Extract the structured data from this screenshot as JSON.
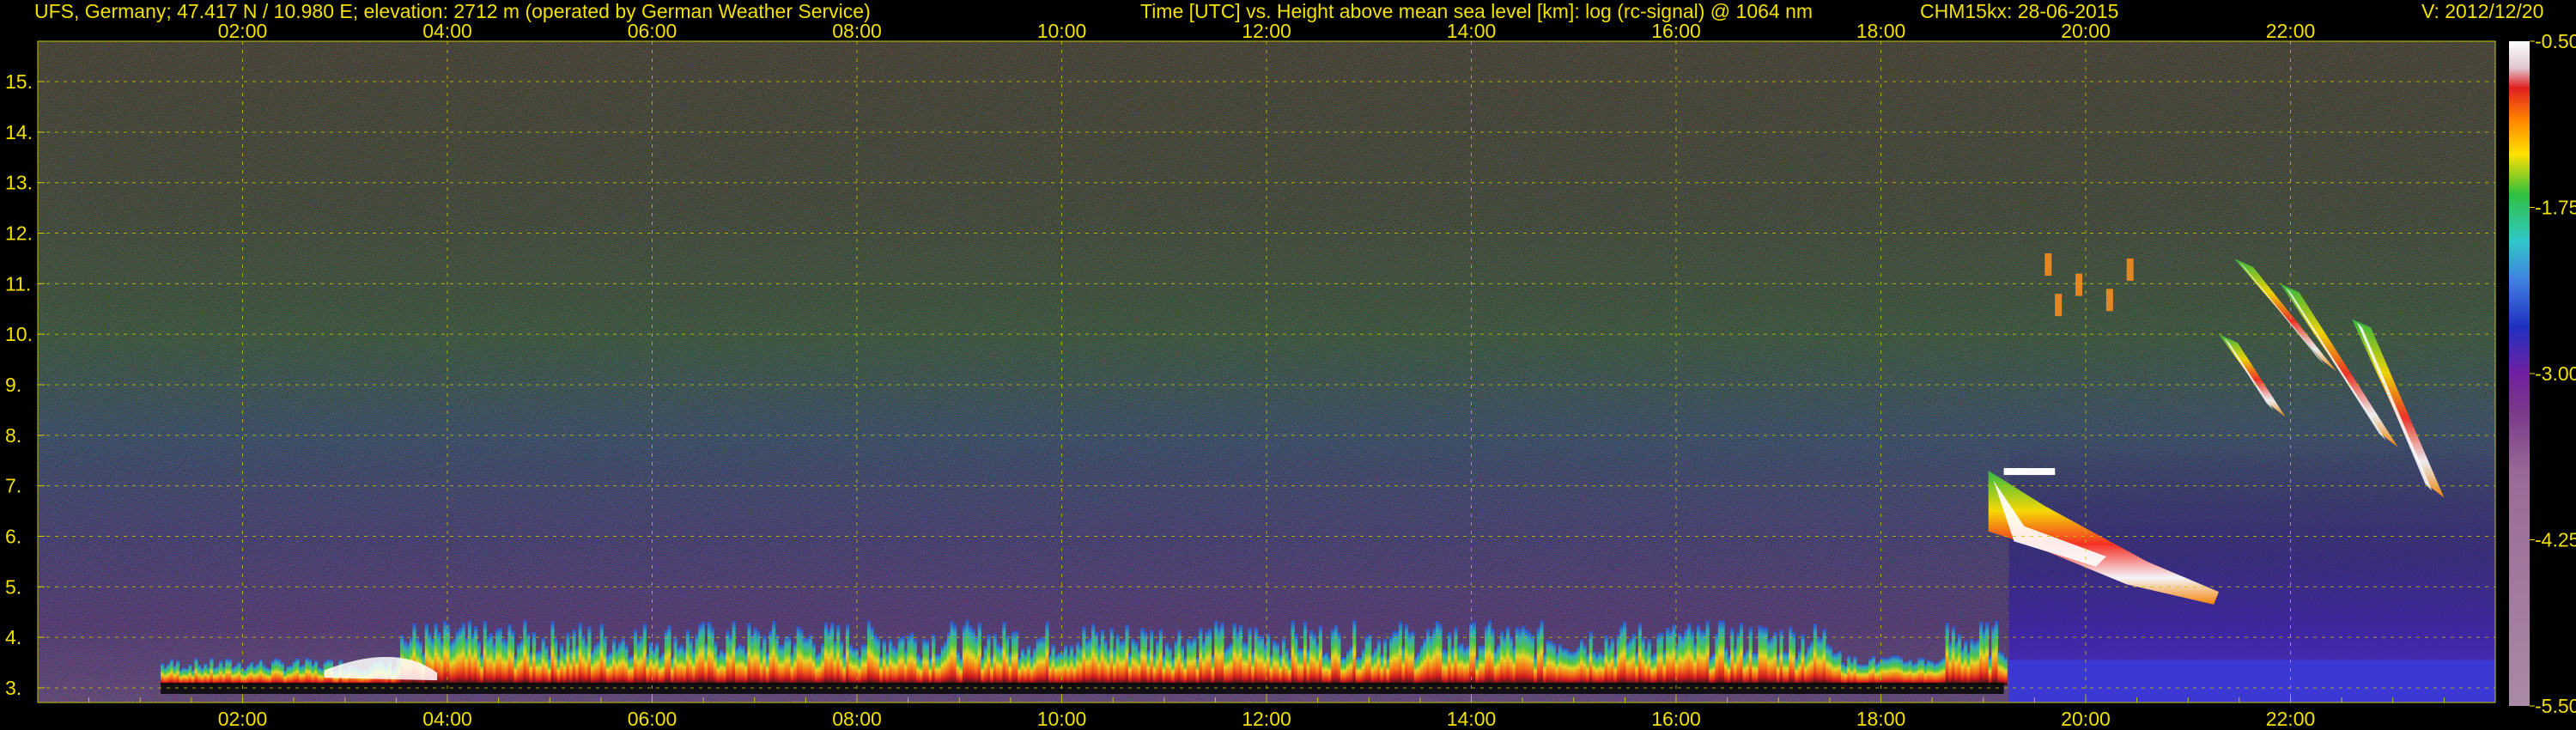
{
  "header": {
    "site": "UFS, Germany; 47.417 N / 10.980 E; elevation: 2712 m  (operated by German Weather Service)",
    "description": "Time [UTC] vs. Height above mean sea level [km]: log (rc-signal) @ 1064 nm",
    "instrument": "CHM15kx: 28-06-2015",
    "version": "V: 2012/12/20"
  },
  "colors": {
    "text": "#f0e000",
    "grid": "#c8c800",
    "background": "#000000"
  },
  "chart_data": {
    "type": "heatmap",
    "title": "Time [UTC] vs. Height above mean sea level [km]: log (rc-signal) @ 1064 nm",
    "x_tick_labels": [
      "02:00",
      "04:00",
      "06:00",
      "08:00",
      "10:00",
      "12:00",
      "14:00",
      "16:00",
      "18:00",
      "20:00",
      "22:00"
    ],
    "x_ticks_hours": [
      2,
      4,
      6,
      8,
      10,
      12,
      14,
      16,
      18,
      20,
      22
    ],
    "xlim_hours": [
      0,
      24
    ],
    "y_tick_labels": [
      "3.",
      "4.",
      "5.",
      "6.",
      "7.",
      "8.",
      "9.",
      "10.",
      "11.",
      "12.",
      "13.",
      "14.",
      "15."
    ],
    "y_ticks_km": [
      3,
      4,
      5,
      6,
      7,
      8,
      9,
      10,
      11,
      12,
      13,
      14,
      15
    ],
    "ylim_km": [
      2.71,
      15.8
    ],
    "grid": true,
    "colorbar": {
      "tick_labels": [
        "-0.50",
        "-1.75",
        "-3.00",
        "-4.25",
        "-5.50"
      ],
      "ticks": [
        -0.5,
        -1.75,
        -3.0,
        -4.25,
        -5.5
      ],
      "range": [
        -5.5,
        -0.5
      ]
    },
    "features": [
      {
        "name": "boundary layer",
        "start_h": 1.2,
        "end_h": 19.2,
        "base_km": 3.1,
        "top_km": 4.3
      },
      {
        "name": "cloud layer low",
        "start_h": 19.0,
        "end_h": 21.3,
        "base_km": 4.8,
        "top_km": 7.3
      },
      {
        "name": "cirrus",
        "start_h": 21.2,
        "end_h": 23.5,
        "base_km": 7.0,
        "top_km": 11.5
      },
      {
        "name": "cirrus fragments",
        "start_h": 19.5,
        "end_h": 20.5,
        "base_km": 10.5,
        "top_km": 11.9
      }
    ]
  }
}
